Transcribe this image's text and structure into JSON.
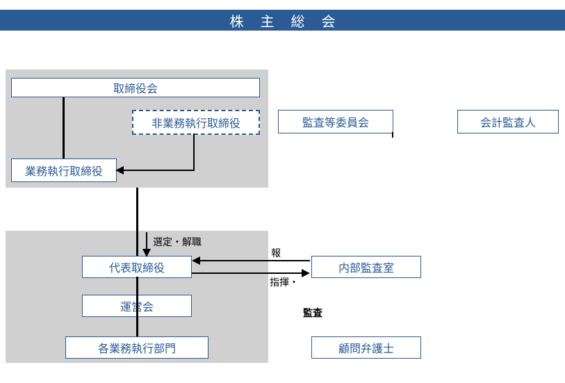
{
  "header": {
    "title": "株主総会"
  },
  "boxes": {
    "board": "取締役会",
    "nonexec": "非業務執行取締役",
    "audit_committee": "監査等委員会",
    "accounting_auditor": "会計監査人",
    "exec_director": "業務執行取締役",
    "rep_director": "代表取締役",
    "steering": "運営会",
    "departments": "各業務執行部門",
    "internal_audit": "内部監査室",
    "legal_advisor": "顧問弁護士"
  },
  "labels": {
    "select_dismiss": "選定・解職",
    "report": "報",
    "direct": "指揮・",
    "audit": "監査"
  }
}
